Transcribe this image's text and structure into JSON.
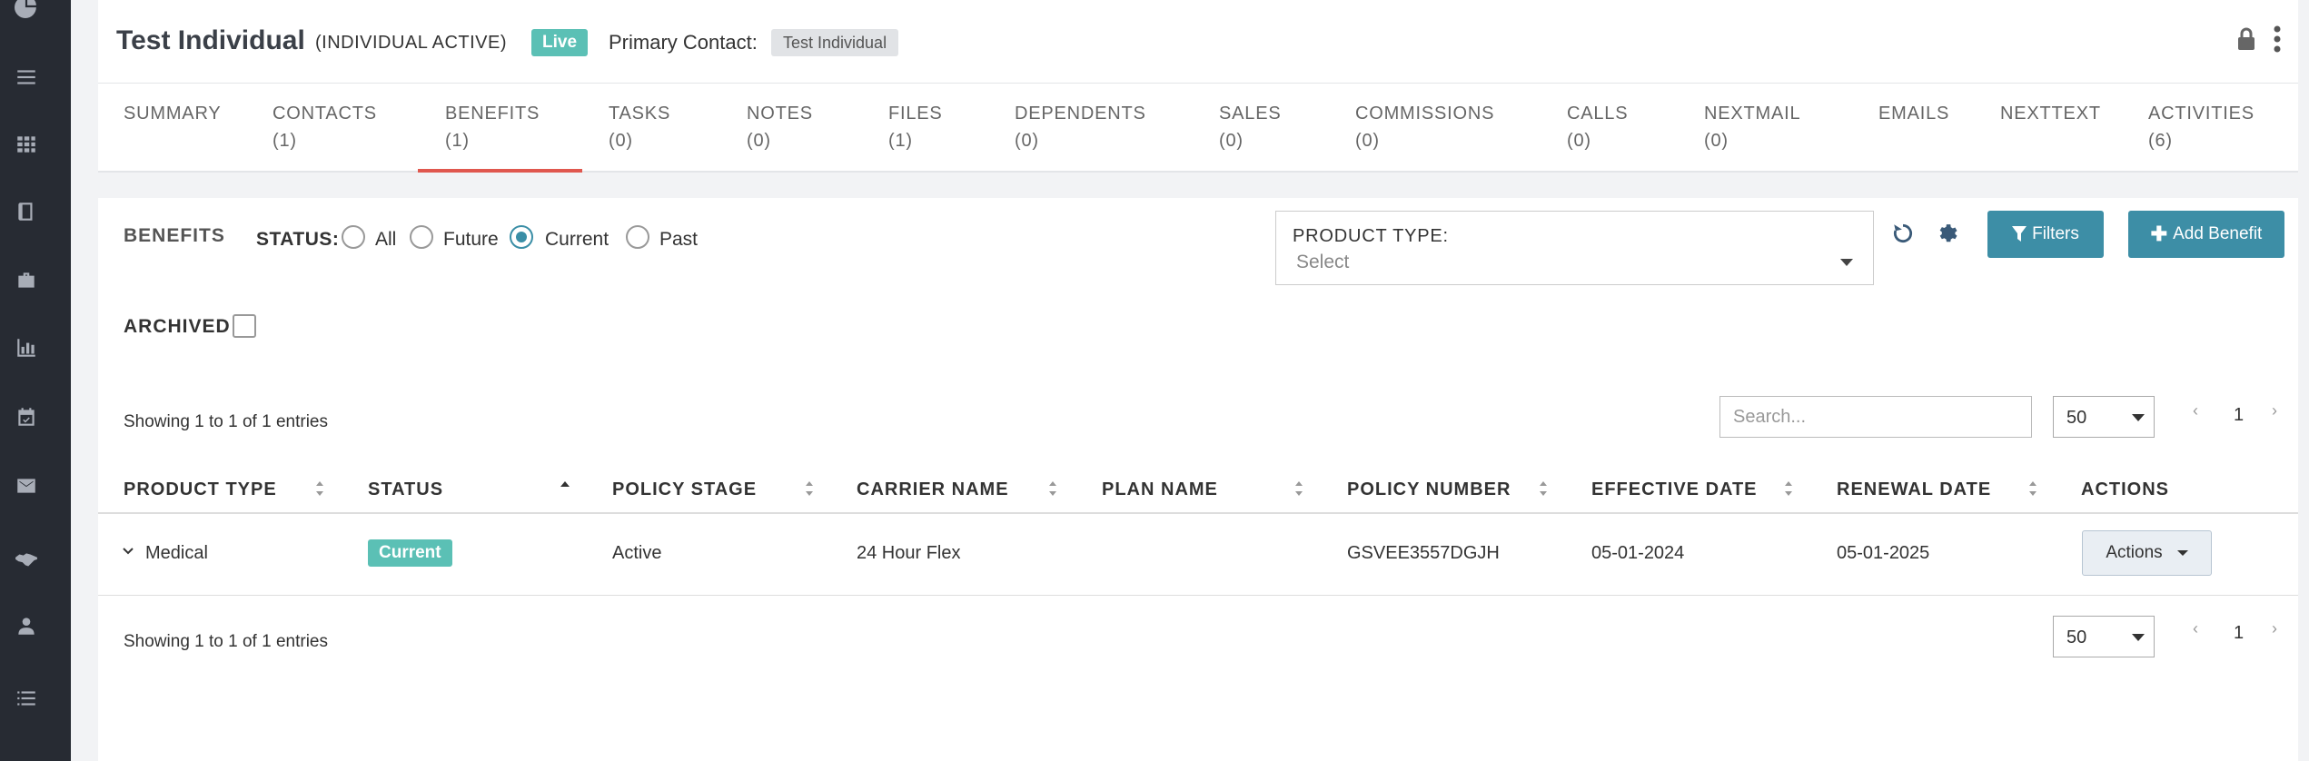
{
  "sidebar": {
    "icons": [
      "pie-chart-icon",
      "list-icon",
      "grid-icon",
      "book-icon",
      "briefcase-icon",
      "bar-chart-icon",
      "calendar-check-icon",
      "envelope-icon",
      "handshake-icon",
      "user-icon",
      "list-bullets-icon"
    ]
  },
  "header": {
    "title": "Test Individual",
    "subtitle": "(INDIVIDUAL ACTIVE)",
    "live_badge": "Live",
    "primary_contact_label": "Primary Contact:",
    "primary_contact_value": "Test Individual"
  },
  "tabs": [
    {
      "label": "SUMMARY",
      "count": ""
    },
    {
      "label": "CONTACTS",
      "count": "(1)"
    },
    {
      "label": "BENEFITS",
      "count": "(1)"
    },
    {
      "label": "TASKS",
      "count": "(0)"
    },
    {
      "label": "NOTES",
      "count": "(0)"
    },
    {
      "label": "FILES",
      "count": "(1)"
    },
    {
      "label": "DEPENDENTS",
      "count": "(0)"
    },
    {
      "label": "SALES",
      "count": "(0)"
    },
    {
      "label": "COMMISSIONS",
      "count": "(0)"
    },
    {
      "label": "CALLS",
      "count": "(0)"
    },
    {
      "label": "NEXTMAIL",
      "count": "(0)"
    },
    {
      "label": "EMAILS",
      "count": ""
    },
    {
      "label": "NEXTTEXT",
      "count": ""
    },
    {
      "label": "ACTIVITIES",
      "count": "(6)"
    }
  ],
  "active_tab": "BENEFITS",
  "benefits": {
    "title": "BENEFITS",
    "status_label": "STATUS:",
    "status_options": [
      "All",
      "Future",
      "Current",
      "Past"
    ],
    "status_selected": "Current",
    "product_type_label": "PRODUCT TYPE:",
    "product_type_placeholder": "Select",
    "filters_button": "Filters",
    "add_button": "Add Benefit",
    "archived_label": "ARCHIVED",
    "archived_checked": false
  },
  "table": {
    "showing_top": "Showing 1 to 1 of 1 entries",
    "showing_bottom": "Showing 1 to 1 of 1 entries",
    "search_placeholder": "Search...",
    "page_size": "50",
    "page": "1",
    "columns": [
      "PRODUCT TYPE",
      "STATUS",
      "POLICY STAGE",
      "CARRIER NAME",
      "PLAN NAME",
      "POLICY NUMBER",
      "EFFECTIVE DATE",
      "RENEWAL DATE",
      "ACTIONS"
    ],
    "rows": [
      {
        "product_type": "Medical",
        "status": "Current",
        "policy_stage": "Active",
        "carrier_name": "24 Hour Flex",
        "plan_name": "",
        "policy_number": "GSVEE3557DGJH",
        "effective_date": "05-01-2024",
        "renewal_date": "05-01-2025",
        "actions_label": "Actions"
      }
    ]
  },
  "colors": {
    "sidebar": "#272b33",
    "accent_teal": "#5bc0b5",
    "button_blue": "#3d8ea6",
    "active_tab_underline": "#e0574e"
  }
}
